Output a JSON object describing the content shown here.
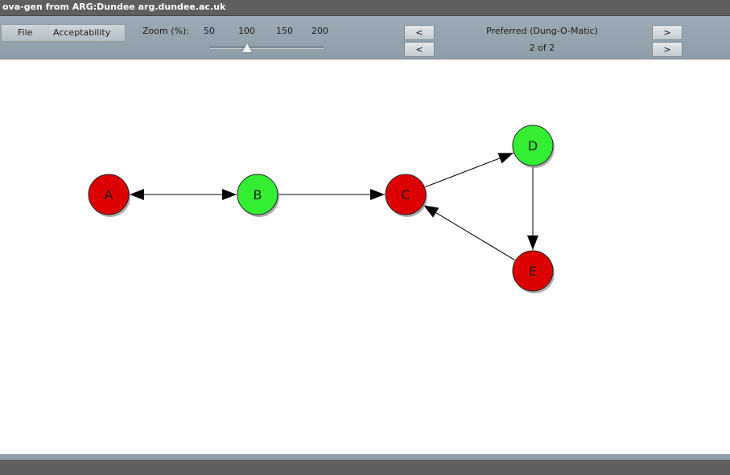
{
  "window": {
    "title": "ova-gen from ARG:Dundee arg.dundee.ac.uk"
  },
  "toolbar": {
    "menu": {
      "file": "File",
      "acceptability": "Acceptability"
    },
    "zoom": {
      "label": "Zoom (%):",
      "ticks": [
        "50",
        "100",
        "150",
        "200"
      ],
      "value": 100
    },
    "semantics": {
      "prev_label": "<",
      "next_label": ">",
      "name": "Preferred (Dung-O-Matic)"
    },
    "extension": {
      "prev_label": "<",
      "next_label": ">",
      "counter": "2 of 2"
    }
  },
  "graph": {
    "colors": {
      "in": "#33ee33",
      "out": "#dd0000"
    },
    "nodes": [
      {
        "id": "A",
        "label": "A",
        "status": "out"
      },
      {
        "id": "B",
        "label": "B",
        "status": "in"
      },
      {
        "id": "C",
        "label": "C",
        "status": "out"
      },
      {
        "id": "D",
        "label": "D",
        "status": "in"
      },
      {
        "id": "E",
        "label": "E",
        "status": "out"
      }
    ],
    "edges": [
      {
        "from": "A",
        "to": "B",
        "bidirectional": true
      },
      {
        "from": "B",
        "to": "C",
        "bidirectional": false
      },
      {
        "from": "C",
        "to": "D",
        "bidirectional": false
      },
      {
        "from": "D",
        "to": "E",
        "bidirectional": false
      },
      {
        "from": "E",
        "to": "C",
        "bidirectional": false
      }
    ]
  }
}
